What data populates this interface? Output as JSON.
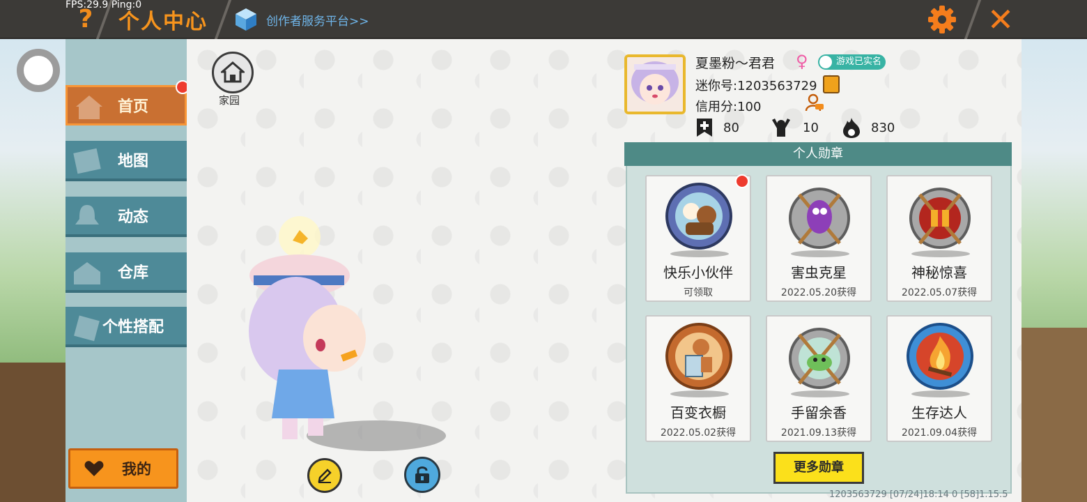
{
  "hud": {
    "fps_text": "FPS:29.9  Ping:0"
  },
  "header": {
    "help_icon": "question-mark-icon",
    "title": "个人中心",
    "creator_link": "创作者服务平台>>",
    "settings_icon": "gear-icon",
    "close_icon": "close-x-icon",
    "accent_color": "#f7941d"
  },
  "sidebar": {
    "items": [
      {
        "label": "首页",
        "icon": "home-icon",
        "active": true,
        "badge": true
      },
      {
        "label": "地图",
        "icon": "map-icon",
        "active": false
      },
      {
        "label": "动态",
        "icon": "bell-icon",
        "active": false
      },
      {
        "label": "仓库",
        "icon": "warehouse-icon",
        "active": false
      },
      {
        "label": "个性搭配",
        "icon": "outfit-icon",
        "active": false
      }
    ],
    "mine_label": "我的"
  },
  "home": {
    "label": "家园"
  },
  "profile": {
    "name": "夏墨粉～君君",
    "gender_symbol": "♀",
    "verified_label": "游戏已实名",
    "id_text": "迷你号:1203563729",
    "credit_text": "信用分:100",
    "stats": {
      "likes": "80",
      "fans": "10",
      "heat": "830"
    }
  },
  "badges": {
    "title": "个人勋章",
    "items": [
      {
        "name": "快乐小伙伴",
        "date": "可领取",
        "badge": true,
        "medal": "friends-medal-icon"
      },
      {
        "name": "害虫克星",
        "date": "2022.05.20获得",
        "medal": "bug-medal-icon"
      },
      {
        "name": "神秘惊喜",
        "date": "2022.05.07获得",
        "medal": "gift-medal-icon"
      },
      {
        "name": "百变衣橱",
        "date": "2022.05.02获得",
        "medal": "wardrobe-medal-icon"
      },
      {
        "name": "手留余香",
        "date": "2021.09.13获得",
        "medal": "flower-medal-icon"
      },
      {
        "name": "生存达人",
        "date": "2021.09.04获得",
        "medal": "campfire-medal-icon"
      }
    ],
    "more_label": "更多勋章"
  },
  "footer": {
    "info": "1203563729   [07/24]18:14 0  [58]1.15.5"
  },
  "colors": {
    "sidebar_item": "#4e8a98",
    "sidebar_active": "#c97032",
    "badge_header": "#4e8a86",
    "more_button": "#fbe01b"
  }
}
